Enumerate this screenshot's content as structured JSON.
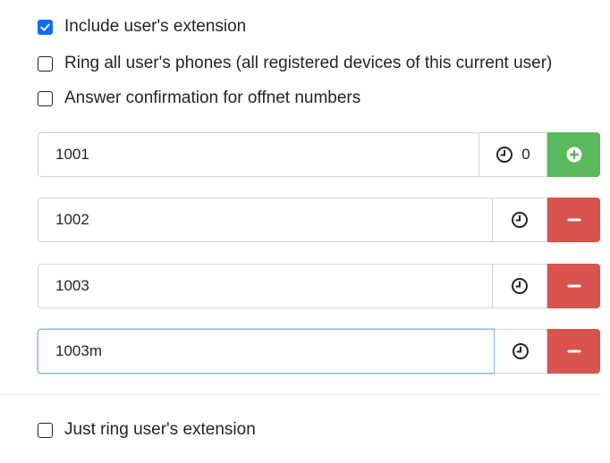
{
  "options": {
    "include_extension": {
      "label": "Include user's extension",
      "checked": true
    },
    "ring_all_phones": {
      "label": "Ring all user's phones (all registered devices of this current user)",
      "checked": false
    },
    "answer_confirmation": {
      "label": "Answer confirmation for offnet numbers",
      "checked": false
    }
  },
  "numbers": [
    {
      "value": "1001",
      "delay": "0",
      "action": "add",
      "icon": "clock-icon",
      "action_icon": "plus-circle-icon"
    },
    {
      "value": "1002",
      "delay": "",
      "action": "remove",
      "icon": "clock-icon",
      "action_icon": "minus-icon"
    },
    {
      "value": "1003",
      "delay": "",
      "action": "remove",
      "icon": "clock-icon",
      "action_icon": "minus-icon"
    },
    {
      "value": "1003m",
      "delay": "",
      "action": "remove",
      "icon": "clock-icon",
      "action_icon": "minus-icon"
    }
  ],
  "footer": {
    "just_ring_extension": {
      "label": "Just ring user's extension",
      "checked": false
    }
  },
  "colors": {
    "checkbox_checked": "#0d6efd",
    "add_button": "#5cb85c",
    "remove_button": "#d9534f",
    "focus_border": "#86b7fe"
  }
}
